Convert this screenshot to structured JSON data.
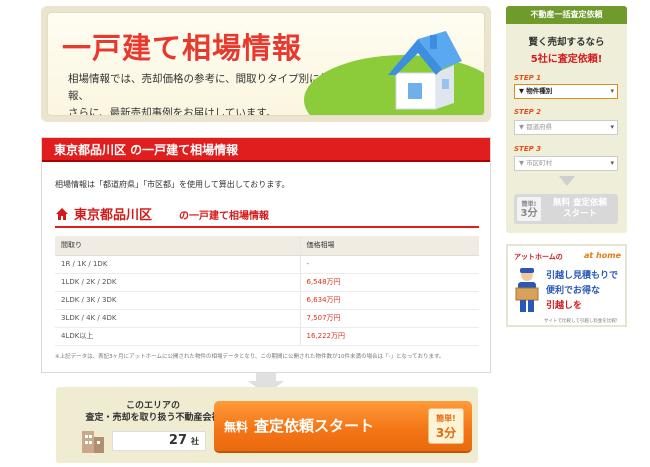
{
  "hero": {
    "title": "一戸建て相場情報",
    "desc_line1": "相場情報では、売却価格の参考に、間取りタイプ別に相場情報、",
    "desc_line2": "さらに、最新売却事例をお届けしています。"
  },
  "section": {
    "header": "東京都品川区 の一戸建て相場情報",
    "calc_note": "相場情報は「都道府県」「市区都」を使用して算出しております。",
    "sub_title_area": "東京都品川区",
    "sub_title_rest": "の一戸建て相場情報",
    "table": {
      "headers": [
        "間取り",
        "価格相場"
      ],
      "rows": [
        {
          "layout": "1R / 1K / 1DK",
          "price": "-"
        },
        {
          "layout": "1LDK / 2K / 2DK",
          "price": "6,548万円"
        },
        {
          "layout": "2LDK / 3K / 3DK",
          "price": "6,634万円"
        },
        {
          "layout": "3LDK / 4K / 4DK",
          "price": "7,507万円"
        },
        {
          "layout": "4LDK以上",
          "price": "16,222万円"
        }
      ]
    },
    "foot_note": "※上記データは、表記3ヶ月にアットホームに公開された物件の相場データとなり、この期間に公開された物件数が10件未満の場合は「-」となっております。"
  },
  "cta": {
    "label_line1": "このエリアの",
    "label_line2": "査定・売却を取り扱う不動産会社",
    "count": "27",
    "count_unit": "社",
    "button_small": "無料",
    "button_main": "査定依頼スタート",
    "badge_line1": "簡単!",
    "badge_line2": "3分"
  },
  "sidebar": {
    "header": "不動産一括査定依頼",
    "catch1": "賢く売却するなら",
    "catch2": "5社に査定依頼!",
    "step1": "STEP 1",
    "step2": "STEP 2",
    "step3": "STEP 3",
    "select1": "▼ 物件種別",
    "select2": "▼ 都道府県",
    "select3": "▼ 市区町村",
    "button_badge1": "簡単!",
    "button_badge2": "3分",
    "button_line1": "無料 査定依頼",
    "button_line2": "スタート"
  },
  "ad": {
    "brand": "アットホームの",
    "logo": "at home",
    "line1": "引越し見積もりで",
    "line2": "便利でお得な",
    "line3": "引越しを",
    "bottom": "サイトで比較して引越し料金を比較!"
  },
  "colors": {
    "accent_red": "#e11e1e",
    "cta_orange": "#f47617",
    "side_green": "#6f9a2c"
  }
}
